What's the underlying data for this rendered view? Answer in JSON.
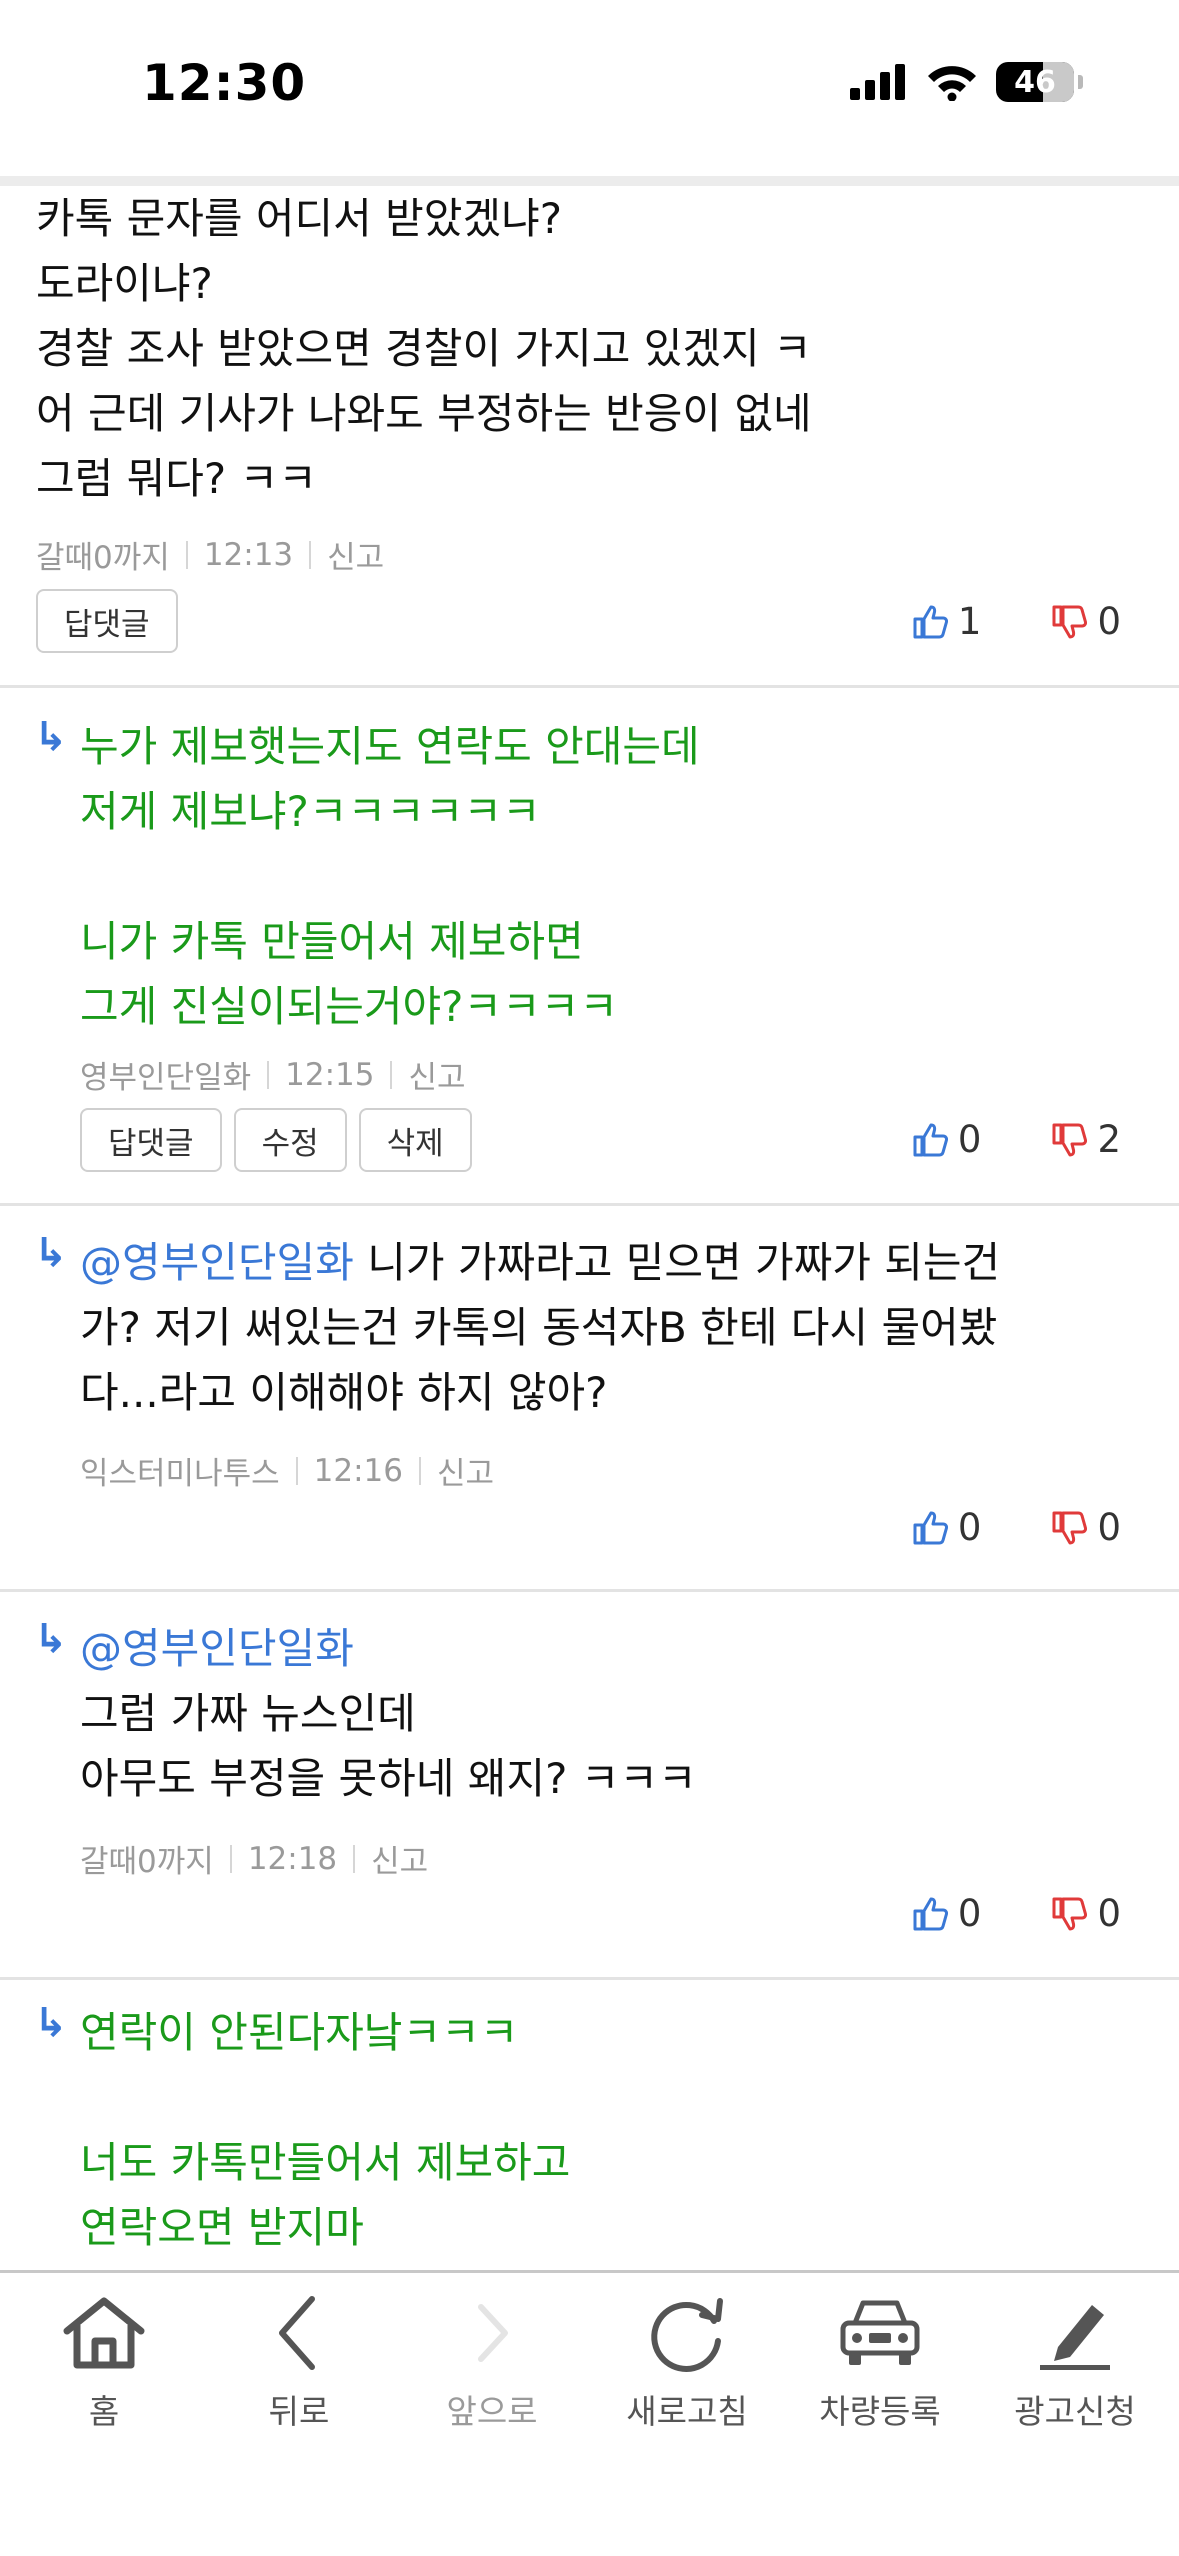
{
  "status_bar": {
    "time": "12:30",
    "battery": "46"
  },
  "comments": [
    {
      "text": "카톡 문자를 어디서 받았겠냐?\n도라이냐?\n경찰 조사 받았으면 경찰이 가지고 있겠지 ㅋ\n어 근데 기사가 나와도 부정하는 반응이 없네\n그럼 뭐다? ㅋㅋ",
      "author": "갈때0까지",
      "time": "12:13",
      "report": "신고",
      "buttons": [
        "답댓글"
      ],
      "up": "1",
      "down": "0"
    },
    {
      "text": "누가 제보햇는지도 연락도 안대는데\n저게 제보냐?ㅋㅋㅋㅋㅋㅋ\n\n니가 카톡 만들어서 제보하면\n그게 진실이되는거야?ㅋㅋㅋㅋ",
      "author": "영부인단일화",
      "time": "12:15",
      "report": "신고",
      "buttons": [
        "답댓글",
        "수정",
        "삭제"
      ],
      "up": "0",
      "down": "2"
    },
    {
      "mention": "@영부인단일화",
      "text": " 니가 가짜라고 믿으면 가짜가 되는건\n가? 저기 써있는건 카톡의 동석자B 한테 다시 물어봤\n다...라고 이해해야 하지 않아?",
      "author": "익스터미나투스",
      "time": "12:16",
      "report": "신고",
      "up": "0",
      "down": "0"
    },
    {
      "mention": "@영부인단일화",
      "text": "그럼 가짜 뉴스인데\n아무도 부정을 못하네 왜지? ㅋㅋㅋ",
      "author": "갈때0까지",
      "time": "12:18",
      "report": "신고",
      "up": "0",
      "down": "0"
    },
    {
      "text": "연락이 안된다자낰ㅋㅋㅋ\n\n너도 카톡만들어서 제보하고\n연락오면 받지마"
    }
  ],
  "toolbar": {
    "home": "홈",
    "back": "뒤로",
    "forward": "앞으로",
    "refresh": "새로고침",
    "car_register": "차량등록",
    "ad_apply": "광고신청"
  },
  "colors": {
    "reply_text": "#1a9a1a",
    "mention": "#3a78d6",
    "thumb_up": "#3a78d6",
    "thumb_down": "#e03a3a"
  }
}
